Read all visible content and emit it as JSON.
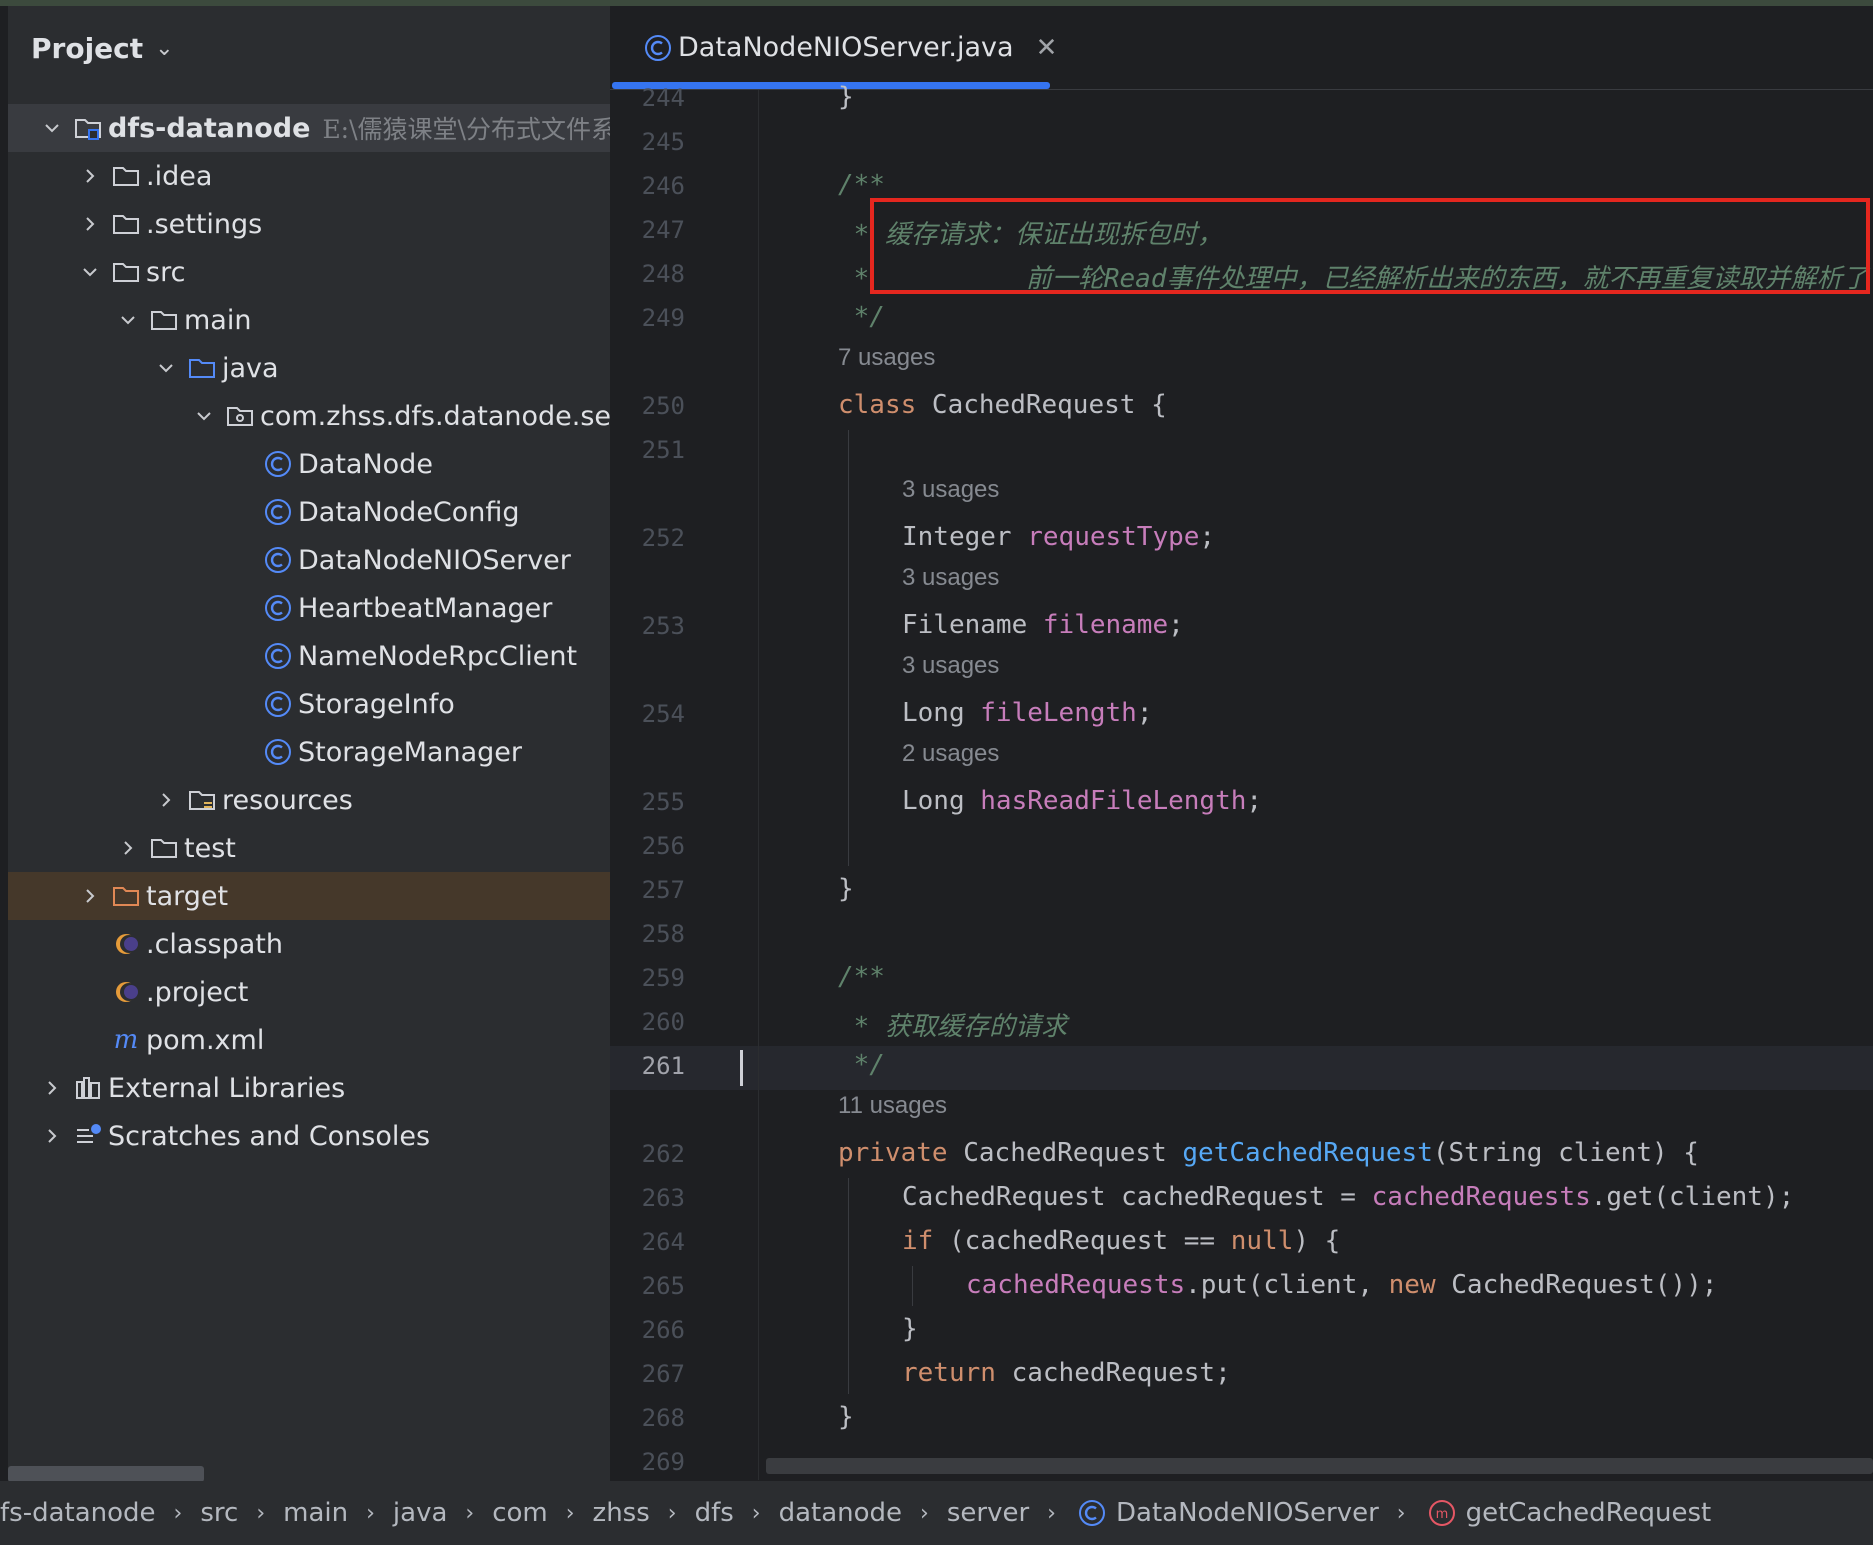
{
  "project_panel": {
    "title": "Project",
    "tree": [
      {
        "label": "dfs-datanode",
        "hint": "E:\\儒猿课堂\\分布式文件系",
        "icon": "module-folder-icon",
        "depth": 0,
        "arrow": "down"
      },
      {
        "label": ".idea",
        "icon": "folder-icon",
        "depth": 1,
        "arrow": "right"
      },
      {
        "label": ".settings",
        "icon": "folder-icon",
        "depth": 1,
        "arrow": "right"
      },
      {
        "label": "src",
        "icon": "folder-icon",
        "depth": 1,
        "arrow": "down"
      },
      {
        "label": "main",
        "icon": "folder-icon",
        "depth": 2,
        "arrow": "down"
      },
      {
        "label": "java",
        "icon": "source-folder-icon",
        "depth": 3,
        "arrow": "down"
      },
      {
        "label": "com.zhss.dfs.datanode.serv",
        "icon": "package-icon",
        "depth": 4,
        "arrow": "down"
      },
      {
        "label": "DataNode",
        "icon": "class-icon",
        "depth": 5,
        "arrow": "none"
      },
      {
        "label": "DataNodeConfig",
        "icon": "class-icon",
        "depth": 5,
        "arrow": "none"
      },
      {
        "label": "DataNodeNIOServer",
        "icon": "class-icon",
        "depth": 5,
        "arrow": "none"
      },
      {
        "label": "HeartbeatManager",
        "icon": "class-icon",
        "depth": 5,
        "arrow": "none"
      },
      {
        "label": "NameNodeRpcClient",
        "icon": "class-icon",
        "depth": 5,
        "arrow": "none"
      },
      {
        "label": "StorageInfo",
        "icon": "class-icon",
        "depth": 5,
        "arrow": "none"
      },
      {
        "label": "StorageManager",
        "icon": "class-icon",
        "depth": 5,
        "arrow": "none"
      },
      {
        "label": "resources",
        "icon": "resources-folder-icon",
        "depth": 3,
        "arrow": "right"
      },
      {
        "label": "test",
        "icon": "folder-icon",
        "depth": 2,
        "arrow": "right"
      },
      {
        "label": "target",
        "icon": "excluded-folder-icon",
        "depth": 1,
        "arrow": "right"
      },
      {
        "label": ".classpath",
        "icon": "eclipse-file-icon",
        "depth": 1,
        "arrow": "none"
      },
      {
        "label": ".project",
        "icon": "eclipse-file-icon",
        "depth": 1,
        "arrow": "none"
      },
      {
        "label": "pom.xml",
        "icon": "maven-icon",
        "depth": 1,
        "arrow": "none"
      },
      {
        "label": "External Libraries",
        "icon": "libraries-icon",
        "depth": 0,
        "arrow": "right"
      },
      {
        "label": "Scratches and Consoles",
        "icon": "scratches-icon",
        "depth": 0,
        "arrow": "right"
      }
    ]
  },
  "editor": {
    "tab": {
      "label": "DataNodeNIOServer.java",
      "icon": "class-icon",
      "close_icon": "close-icon"
    },
    "current_line": "261",
    "lines": [
      {
        "n": "244",
        "tokens": [
          {
            "t": "}",
            "c": ""
          }
        ],
        "indent": 1
      },
      {
        "n": "245",
        "tokens": [],
        "indent": 1
      },
      {
        "n": "246",
        "tokens": [
          {
            "t": "/**",
            "c": "cmt"
          }
        ],
        "indent": 1
      },
      {
        "n": "247",
        "tokens": [
          {
            "t": " * ",
            "c": "cmt"
          },
          {
            "t": "缓存请求：保证出现拆包时，",
            "c": "cmt-cn"
          }
        ],
        "indent": 1
      },
      {
        "n": "248",
        "tokens": [
          {
            "t": " *          ",
            "c": "cmt"
          },
          {
            "t": "前一轮",
            "c": "cmt-cn"
          },
          {
            "t": "Read",
            "c": "cmt"
          },
          {
            "t": "事件处理中，已经解析出来的东西，就不再重复读取并解析了",
            "c": "cmt-cn"
          }
        ],
        "indent": 1
      },
      {
        "n": "249",
        "tokens": [
          {
            "t": " */",
            "c": "cmt"
          }
        ],
        "indent": 1
      },
      {
        "hint": "7 usages",
        "indent": 1
      },
      {
        "n": "250",
        "tokens": [
          {
            "t": "class ",
            "c": "kw"
          },
          {
            "t": "CachedRequest {",
            "c": ""
          }
        ],
        "indent": 1
      },
      {
        "n": "251",
        "tokens": [],
        "indent": 1
      },
      {
        "hint": "3 usages",
        "indent": 2
      },
      {
        "n": "252",
        "tokens": [
          {
            "t": "Integer ",
            "c": ""
          },
          {
            "t": "requestType",
            "c": "fld"
          },
          {
            "t": ";",
            "c": ""
          }
        ],
        "indent": 2
      },
      {
        "hint": "3 usages",
        "indent": 2
      },
      {
        "n": "253",
        "tokens": [
          {
            "t": "Filename ",
            "c": ""
          },
          {
            "t": "filename",
            "c": "fld"
          },
          {
            "t": ";",
            "c": ""
          }
        ],
        "indent": 2
      },
      {
        "hint": "3 usages",
        "indent": 2
      },
      {
        "n": "254",
        "tokens": [
          {
            "t": "Long ",
            "c": ""
          },
          {
            "t": "fileLength",
            "c": "fld"
          },
          {
            "t": ";",
            "c": ""
          }
        ],
        "indent": 2
      },
      {
        "hint": "2 usages",
        "indent": 2
      },
      {
        "n": "255",
        "tokens": [
          {
            "t": "Long ",
            "c": ""
          },
          {
            "t": "hasReadFileLength",
            "c": "fld"
          },
          {
            "t": ";",
            "c": ""
          }
        ],
        "indent": 2
      },
      {
        "n": "256",
        "tokens": [],
        "indent": 1
      },
      {
        "n": "257",
        "tokens": [
          {
            "t": "}",
            "c": ""
          }
        ],
        "indent": 1
      },
      {
        "n": "258",
        "tokens": [],
        "indent": 1
      },
      {
        "n": "259",
        "tokens": [
          {
            "t": "/**",
            "c": "cmt"
          }
        ],
        "indent": 1
      },
      {
        "n": "260",
        "tokens": [
          {
            "t": " * ",
            "c": "cmt"
          },
          {
            "t": "获取缓存的请求",
            "c": "cmt-cn"
          }
        ],
        "indent": 1
      },
      {
        "n": "261",
        "tokens": [
          {
            "t": " */",
            "c": "cmt"
          }
        ],
        "indent": 1
      },
      {
        "hint": "11 usages",
        "indent": 1
      },
      {
        "n": "262",
        "tokens": [
          {
            "t": "private ",
            "c": "kw"
          },
          {
            "t": "CachedRequest ",
            "c": ""
          },
          {
            "t": "getCachedRequest",
            "c": "fn"
          },
          {
            "t": "(String client) {",
            "c": ""
          }
        ],
        "indent": 1
      },
      {
        "n": "263",
        "tokens": [
          {
            "t": "CachedRequest cachedRequest = ",
            "c": ""
          },
          {
            "t": "cachedRequests",
            "c": "fld"
          },
          {
            "t": ".get(client);",
            "c": ""
          }
        ],
        "indent": 2
      },
      {
        "n": "264",
        "tokens": [
          {
            "t": "if ",
            "c": "kw"
          },
          {
            "t": "(cachedRequest == ",
            "c": ""
          },
          {
            "t": "null",
            "c": "kw"
          },
          {
            "t": ") {",
            "c": ""
          }
        ],
        "indent": 2
      },
      {
        "n": "265",
        "tokens": [
          {
            "t": "cachedRequests",
            "c": "fld"
          },
          {
            "t": ".put(client, ",
            "c": ""
          },
          {
            "t": "new ",
            "c": "kw"
          },
          {
            "t": "CachedRequest());",
            "c": ""
          }
        ],
        "indent": 3
      },
      {
        "n": "266",
        "tokens": [
          {
            "t": "}",
            "c": ""
          }
        ],
        "indent": 2
      },
      {
        "n": "267",
        "tokens": [
          {
            "t": "return ",
            "c": "kw"
          },
          {
            "t": "cachedRequest;",
            "c": ""
          }
        ],
        "indent": 2
      },
      {
        "n": "268",
        "tokens": [
          {
            "t": "}",
            "c": ""
          }
        ],
        "indent": 1
      },
      {
        "n": "269",
        "tokens": [],
        "indent": 1
      }
    ],
    "highlight_color": "#e5271f"
  },
  "breadcrumb": [
    {
      "label": "fs-datanode",
      "icon": ""
    },
    {
      "label": "src",
      "icon": ""
    },
    {
      "label": "main",
      "icon": ""
    },
    {
      "label": "java",
      "icon": ""
    },
    {
      "label": "com",
      "icon": ""
    },
    {
      "label": "zhss",
      "icon": ""
    },
    {
      "label": "dfs",
      "icon": ""
    },
    {
      "label": "datanode",
      "icon": ""
    },
    {
      "label": "server",
      "icon": ""
    },
    {
      "label": "DataNodeNIOServer",
      "icon": "class-icon"
    },
    {
      "label": "getCachedRequest",
      "icon": "method-icon"
    }
  ],
  "colors": {
    "accent": "#3574f0",
    "keyword": "#cf8e6d",
    "field": "#c77dbb",
    "method": "#56a8f5",
    "comment": "#5f826b"
  }
}
